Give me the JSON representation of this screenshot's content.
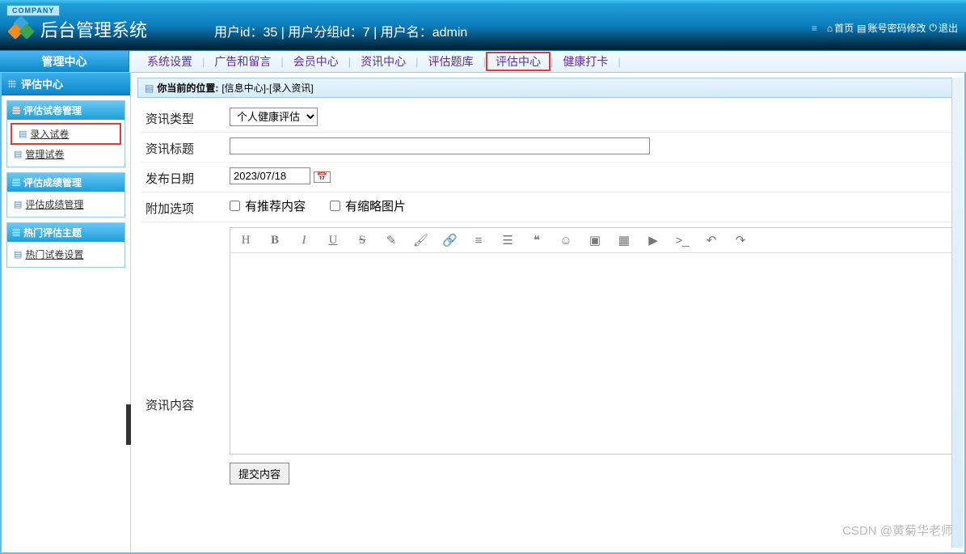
{
  "header": {
    "company_tag": "COMPANY",
    "app_title": "后台管理系统",
    "user_info": "用户id：35 | 用户分组id：7 | 用户名：admin",
    "actions": {
      "home": "首页",
      "password": "账号密码修改",
      "logout": "退出"
    }
  },
  "mgmt_center_label": "管理中心",
  "top_menu": [
    {
      "label": "系统设置",
      "highlight": false
    },
    {
      "label": "广告和留言",
      "highlight": false
    },
    {
      "label": "会员中心",
      "highlight": false
    },
    {
      "label": "资讯中心",
      "highlight": false
    },
    {
      "label": "评估题库",
      "highlight": false
    },
    {
      "label": "评估中心",
      "highlight": true
    },
    {
      "label": "健康打卡",
      "highlight": false
    }
  ],
  "sidebar": {
    "title": "评估中心",
    "panels": [
      {
        "title": "评估试卷管理",
        "items": [
          {
            "label": "录入试卷",
            "highlight": true
          },
          {
            "label": "管理试卷",
            "highlight": false
          }
        ]
      },
      {
        "title": "评估成绩管理",
        "items": [
          {
            "label": "评估成绩管理",
            "highlight": false
          }
        ]
      },
      {
        "title": "热门评估主题",
        "items": [
          {
            "label": "热门试卷设置",
            "highlight": false
          }
        ]
      }
    ]
  },
  "breadcrumb": {
    "prefix": "你当前的位置:",
    "path": "[信息中心]-[录入资讯]"
  },
  "form": {
    "type_label": "资讯类型",
    "type_value": "个人健康评估",
    "title_label": "资讯标题",
    "title_value": "",
    "date_label": "发布日期",
    "date_value": "2023/07/18",
    "extra_label": "附加选项",
    "extra_opts": {
      "recommend": "有推荐内容",
      "thumbnail": "有缩略图片"
    },
    "content_label": "资讯内容",
    "submit_label": "提交内容"
  },
  "editor_toolbar": [
    "H",
    "B",
    "I",
    "U",
    "S",
    "brush",
    "paint",
    "link",
    "ol",
    "ul",
    "quote",
    "emoji",
    "image",
    "table",
    "video",
    "code",
    "undo",
    "redo"
  ],
  "watermark": "CSDN @黄菊华老师"
}
